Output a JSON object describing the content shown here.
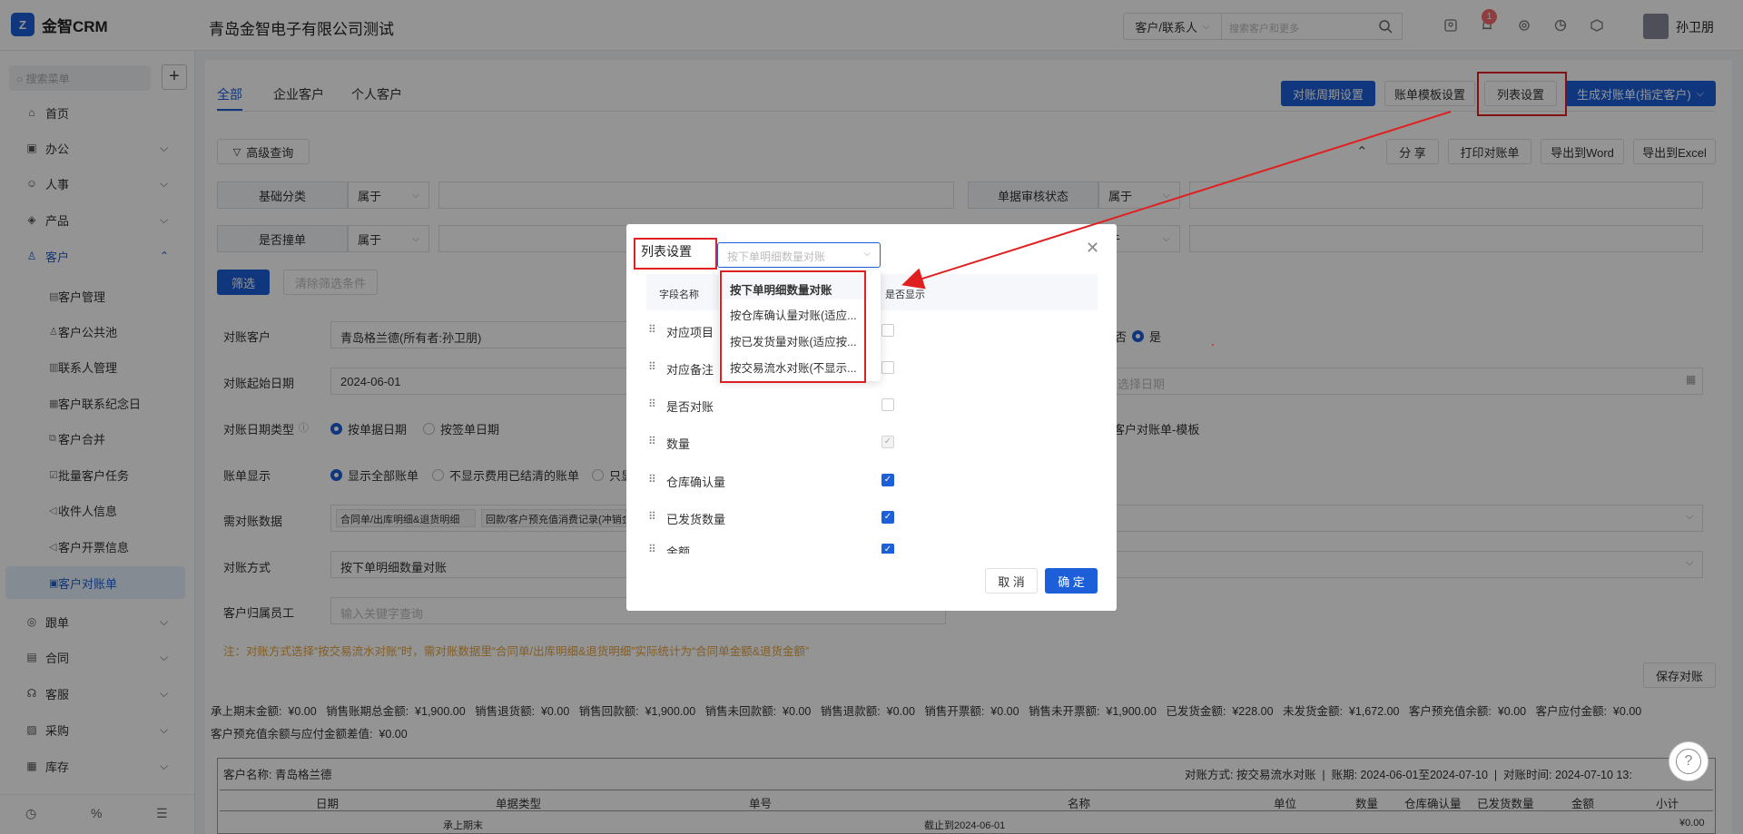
{
  "app": {
    "logo_mark": "Z",
    "name": "金智CRM",
    "company": "青岛金智电子有限公司测试"
  },
  "header": {
    "search_scope": "客户/联系人",
    "search_placeholder": "搜索客户和更多",
    "notification_count": "1",
    "user_name": "孙卫朋"
  },
  "sidebar": {
    "search_placeholder": "搜索菜单",
    "add_label": "+",
    "menus": [
      {
        "label": "首页"
      },
      {
        "label": "办公"
      },
      {
        "label": "人事"
      },
      {
        "label": "产品"
      },
      {
        "label": "客户"
      }
    ],
    "customer_sub": [
      {
        "label": "客户管理"
      },
      {
        "label": "客户公共池"
      },
      {
        "label": "联系人管理"
      },
      {
        "label": "客户联系纪念日"
      },
      {
        "label": "客户合并"
      },
      {
        "label": "批量客户任务"
      },
      {
        "label": "收件人信息"
      },
      {
        "label": "客户开票信息"
      },
      {
        "label": "客户对账单"
      }
    ],
    "menus_after": [
      {
        "label": "跟单"
      },
      {
        "label": "合同"
      },
      {
        "label": "客服"
      },
      {
        "label": "采购"
      },
      {
        "label": "库存"
      }
    ]
  },
  "tabs": [
    {
      "label": "全部"
    },
    {
      "label": "企业客户"
    },
    {
      "label": "个人客户"
    }
  ],
  "toolbar": {
    "cycle_settings": "对账周期设置",
    "template_settings": "账单模板设置",
    "list_settings": "列表设置",
    "generate": "生成对账单(指定客户)",
    "advanced_query": "高级查询",
    "share": "分 享",
    "print": "打印对账单",
    "export_word": "导出到Word",
    "export_excel": "导出到Excel"
  },
  "filters": {
    "row1": {
      "label": "基础分类",
      "op": "属于",
      "right_label": "单据审核状态",
      "right_op": "属于"
    },
    "row2": {
      "label": "是否撞单",
      "op": "属于",
      "right_op_partial": "于"
    },
    "filter_btn": "筛选",
    "clear_btn": "清除筛选条件"
  },
  "form": {
    "customer_label": "对账客户",
    "customer_value": "青岛格兰德(所有者:孙卫朋)",
    "start_label": "对账起始日期",
    "start_value": "2024-06-01",
    "end_placeholder": "选择日期",
    "date_type_label": "对账日期类型",
    "date_type_options": [
      "按单据日期",
      "按签单日期"
    ],
    "display_label": "账单显示",
    "display_options": [
      "显示全部账单",
      "不显示费用已结清的账单",
      "只显"
    ],
    "yesno_partial": "否",
    "yes_label": "是",
    "template_partial": "客户对账单-模板",
    "data_label": "需对账数据",
    "data_tags": [
      "合同单/出库明细&退货明细",
      "回款/客户预充值消费记录(冲销金"
    ],
    "method_label": "对账方式",
    "method_value": "按下单明细数量对账",
    "staff_label": "客户归属员工",
    "staff_placeholder": "输入关键字查询",
    "note": "注：对账方式选择“按交易流水对账”时，需对账数据里“合同单/出库明细&退货明细”实际统计为“合同单金额&退货金额”",
    "save_btn": "保存对账"
  },
  "summary": {
    "line1": "承上期末金额:  ¥0.00   销售账期总金额:  ¥1,900.00   销售退货额:  ¥0.00   销售回款额:  ¥1,900.00   销售未回款额:  ¥0.00   销售退款额:  ¥0.00   销售开票额:  ¥0.00   销售未开票额:  ¥1,900.00   已发货金额:  ¥228.00   未发货金额:  ¥1,672.00   客户预充值余额:  ¥0.00   客户应付金额:  ¥0.00",
    "line2": "客户预充值余额与应付金额差值:  ¥0.00"
  },
  "statement": {
    "customer": "客户名称:  青岛格兰德",
    "meta": "对账方式: 按交易流水对账  |  账期: 2024-06-01至2024-07-10  |  对账时间: 2024-07-10 13:",
    "columns": [
      "日期",
      "单据类型",
      "单号",
      "名称",
      "单位",
      "数量",
      "仓库确认量",
      "已发货数量",
      "金额",
      "小计"
    ],
    "row1": {
      "type": "承上期末",
      "name": "截止到2024-06-01",
      "subtotal": "¥0.00"
    }
  },
  "modal": {
    "title": "列表设置",
    "select_placeholder": "按下单明细数量对账",
    "col_field": "字段名称",
    "col_show": "是否显示",
    "rows": [
      {
        "name": "对应项目",
        "state": "off"
      },
      {
        "name": "对应备注",
        "state": "off"
      },
      {
        "name": "是否对账",
        "state": "off"
      },
      {
        "name": "数量",
        "state": "disabled"
      },
      {
        "name": "仓库确认量",
        "state": "on"
      },
      {
        "name": "已发货数量",
        "state": "on"
      },
      {
        "name": "金额",
        "state": "on"
      }
    ],
    "dropdown_options": [
      "按下单明细数量对账",
      "按仓库确认量对账(适应...",
      "按已发货量对账(适应按...",
      "按交易流水对账(不显示..."
    ],
    "cancel": "取 消",
    "ok": "确 定",
    "help": "?"
  },
  "colors": {
    "accent": "#1d5fd8",
    "annotation_red": "#e02020",
    "warning_text": "#e6a23c"
  }
}
